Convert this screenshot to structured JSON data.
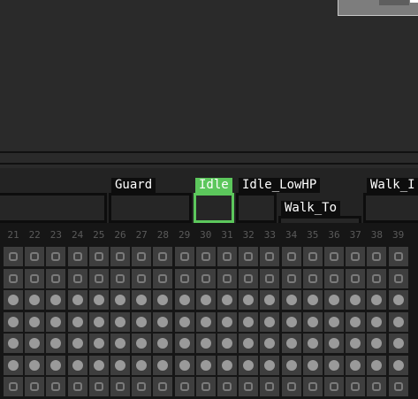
{
  "colors": {
    "background": "#2a2a2a",
    "tag_active": "#5cc75c",
    "tag_inactive": "#0d0d0d",
    "cell": "#3e3e3e",
    "frame_number": "#5a5a5a"
  },
  "tags": [
    {
      "label": "",
      "active": false
    },
    {
      "label": "Guard",
      "active": false
    },
    {
      "label": "Idle",
      "active": true
    },
    {
      "label": "Idle_LowHP",
      "active": false
    },
    {
      "label": "Walk_To",
      "active": false
    },
    {
      "label": "Walk_I",
      "active": false
    }
  ],
  "timeline": {
    "frame_numbers": [
      "21",
      "22",
      "23",
      "24",
      "25",
      "26",
      "27",
      "28",
      "29",
      "30",
      "31",
      "32",
      "33",
      "34",
      "35",
      "36",
      "37",
      "38",
      "39"
    ],
    "rows": [
      "empty",
      "empty",
      "full",
      "full",
      "full",
      "full",
      "empty"
    ]
  }
}
